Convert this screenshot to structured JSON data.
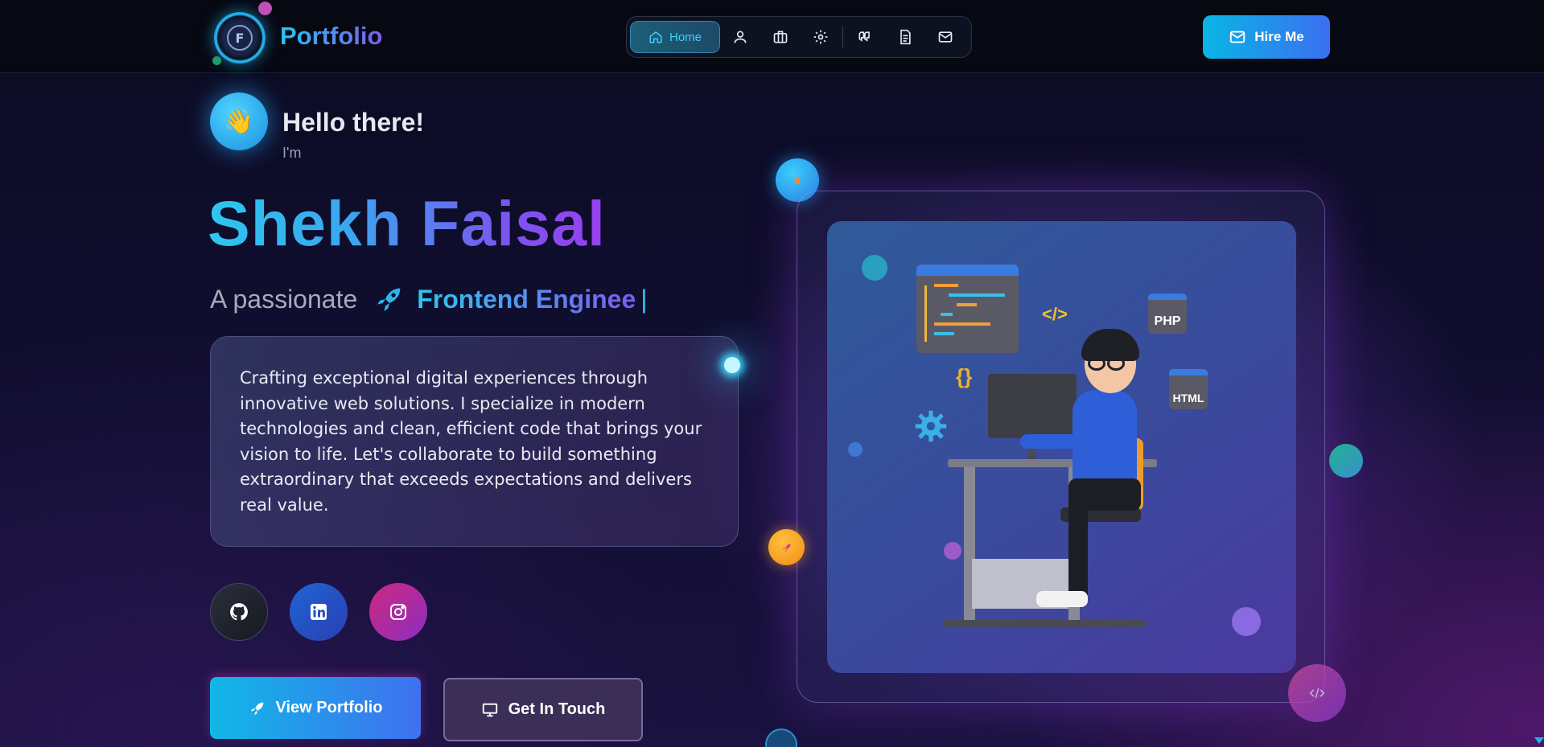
{
  "nav": {
    "brand": "Portfolio",
    "home_label": "Home",
    "icons": [
      "user-icon",
      "briefcase-icon",
      "gear-icon",
      "quote-icon",
      "document-icon",
      "mail-icon"
    ],
    "hire_label": "Hire Me"
  },
  "hero": {
    "greeting": "Hello there!",
    "intro": "I'm",
    "name": "Shekh Faisal",
    "tagline_prefix": "A passionate",
    "role": "Frontend Enginee",
    "cursor": "|",
    "description": "Crafting exceptional digital experiences through innovative web solutions. I specialize in modern technologies and clean, efficient code that brings your vision to life. Let's collaborate to build something extraordinary that exceeds expectations and delivers real value."
  },
  "social": [
    "github-icon",
    "linkedin-icon",
    "instagram-icon"
  ],
  "buttons": {
    "portfolio": "View Portfolio",
    "contact": "Get In Touch"
  },
  "illustration": {
    "code_tag": "</>",
    "braces": "{}",
    "chip_php": "PHP",
    "chip_html": "HTML"
  },
  "colors": {
    "accent_cyan": "#22c3ee",
    "accent_purple": "#7b5cf0",
    "background": "#0f0e2c"
  }
}
